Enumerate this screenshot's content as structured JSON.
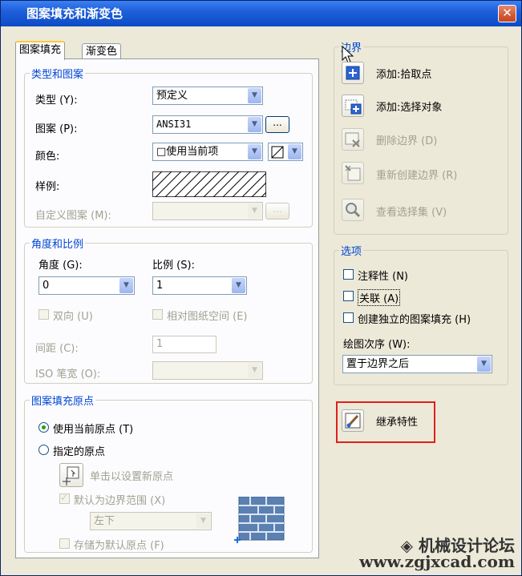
{
  "window": {
    "title": "图案填充和渐变色",
    "close_glyph": "✕"
  },
  "tabs": [
    {
      "label": "图案填充",
      "active": true
    },
    {
      "label": "渐变色",
      "active": false
    }
  ],
  "type_pattern": {
    "legend": "类型和图案",
    "type_label": "类型 (Y):",
    "type_value": "预定义",
    "pattern_label": "图案 (P):",
    "pattern_value": "ANSI31",
    "browse_label": "...",
    "color_label": "颜色:",
    "color_value": "□使用当前项",
    "swatch_label": "样例:",
    "custom_label": "自定义图案 (M):",
    "custom_value": ""
  },
  "angle_scale": {
    "legend": "角度和比例",
    "angle_label": "角度 (G):",
    "angle_value": "0",
    "scale_label": "比例 (S):",
    "scale_value": "1",
    "double_label": "双向 (U)",
    "relative_label": "相对图纸空间 (E)",
    "spacing_label": "间距 (C):",
    "spacing_value": "1",
    "iso_label": "ISO 笔宽 (O):",
    "iso_value": ""
  },
  "origin": {
    "legend": "图案填充原点",
    "use_current_label": "使用当前原点 (T)",
    "specified_label": "指定的原点",
    "click_set_label": "单击以设置新原点",
    "default_extent_label": "默认为边界范围 (X)",
    "position_value": "左下",
    "store_default_label": "存储为默认原点 (F)"
  },
  "boundaries": {
    "legend": "边界",
    "items": [
      {
        "label": "添加:拾取点",
        "icon": "add-pick-points-icon",
        "enabled": true
      },
      {
        "label": "添加:选择对象",
        "icon": "add-select-objects-icon",
        "enabled": true
      },
      {
        "label": "删除边界 (D)",
        "icon": "remove-boundaries-icon",
        "enabled": false
      },
      {
        "label": "重新创建边界 (R)",
        "icon": "recreate-boundary-icon",
        "enabled": false
      },
      {
        "label": "查看选择集 (V)",
        "icon": "magnifier-icon",
        "enabled": false
      }
    ]
  },
  "options": {
    "legend": "选项",
    "annotative_label": "注释性 (N)",
    "associative_label": "关联 (A)",
    "separate_label": "创建独立的图案填充 (H)",
    "draw_order_label": "绘图次序 (W):",
    "draw_order_value": "置于边界之后"
  },
  "inherit": {
    "label": "继承特性",
    "highlight_color": "#e0201c"
  },
  "watermark": {
    "title": "机械设计论坛",
    "url": "www.zgjxcad.com"
  }
}
